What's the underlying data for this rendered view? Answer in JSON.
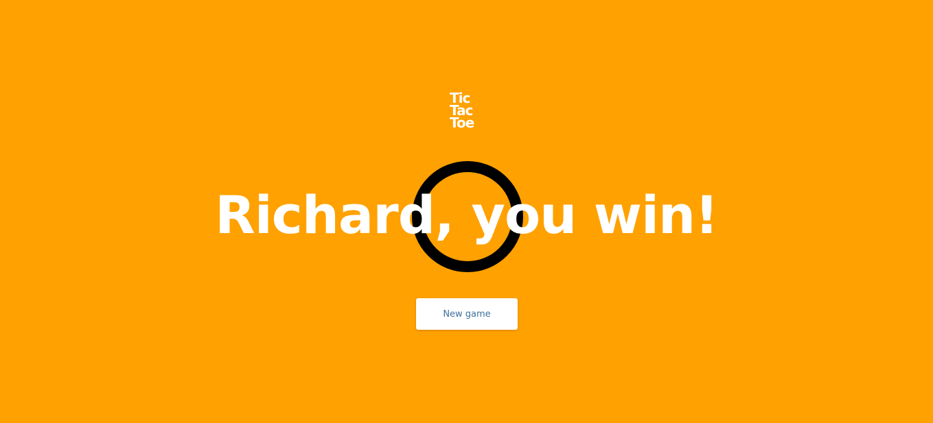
{
  "logo": {
    "lines": [
      "Tic",
      "Tac",
      "Toe"
    ]
  },
  "result": {
    "headline": "Richard, you win!",
    "winning_mark": "o-mark-icon"
  },
  "actions": {
    "new_game_label": "New game"
  },
  "colors": {
    "background": "#FFA100",
    "text": "#FFFFFF",
    "mark": "#000000",
    "button_text": "#3D6F9E"
  }
}
